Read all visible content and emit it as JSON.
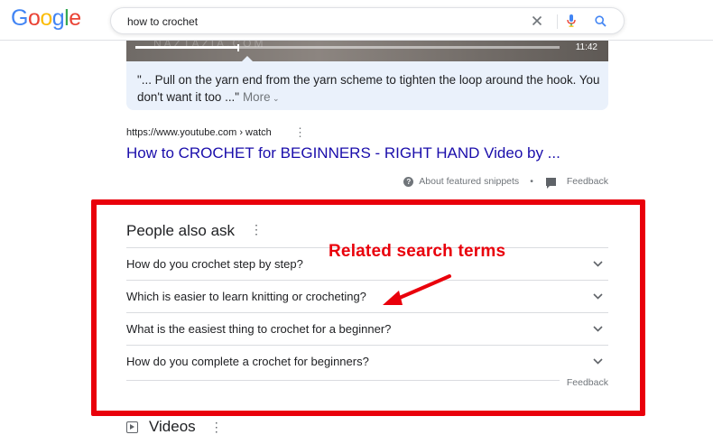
{
  "header": {
    "logo": [
      "G",
      "o",
      "o",
      "g",
      "l",
      "e"
    ],
    "logo_colors": [
      "#4285F4",
      "#EA4335",
      "#FBBC05",
      "#4285F4",
      "#34A853",
      "#EA4335"
    ],
    "search_query": "how to crochet"
  },
  "video": {
    "watermark": "NAZTAZIA.COM",
    "duration": "11:42",
    "progress_fraction": 0.24
  },
  "snippet": {
    "text": "\"... Pull on the yarn end from the yarn scheme to tighten the loop around the hook. You don't want it too ...\"",
    "more_label": "More"
  },
  "result": {
    "cite": "https://www.youtube.com › watch",
    "title": "How to CROCHET for BEGINNERS - RIGHT HAND Video by ..."
  },
  "snippet_footer": {
    "about_label": "About featured snippets",
    "separator": "•",
    "feedback_label": "Feedback"
  },
  "annotation": {
    "label": "Related search terms",
    "color": "#e9000b"
  },
  "people_also_ask": {
    "title": "People also ask",
    "questions": [
      "How do you crochet step by step?",
      "Which is easier to learn knitting or crocheting?",
      "What is the easiest thing to crochet for a beginner?",
      "How do you complete a crochet for beginners?"
    ],
    "feedback_label": "Feedback"
  },
  "videos": {
    "title": "Videos"
  },
  "colors": {
    "link": "#1a0dab",
    "snippet_bg": "#eaf1fb",
    "muted": "#70757a"
  }
}
